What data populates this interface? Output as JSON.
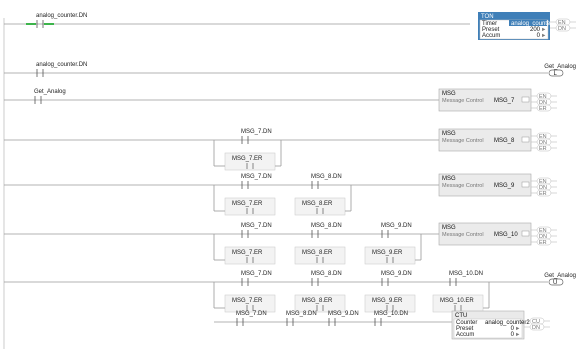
{
  "rungs": [
    {
      "contacts": [
        "analog_counter.DN"
      ],
      "instruction": {
        "type": "TON",
        "rows": [
          {
            "label": "Timer",
            "value": "analog_counter"
          },
          {
            "label": "Preset",
            "value": "200"
          },
          {
            "label": "Accum",
            "value": "0"
          }
        ],
        "outputs": [
          "EN",
          "DN"
        ]
      }
    },
    {
      "contacts": [
        "analog_counter.DN"
      ],
      "coil": {
        "tag": "Get_Analog",
        "type": "L"
      }
    },
    {
      "contacts": [
        "Get_Analog"
      ],
      "instruction": {
        "type": "MSG",
        "label": "Message Control",
        "tag": "MSG_7",
        "outputs": [
          "EN",
          "DN",
          "ER"
        ]
      }
    },
    {
      "contacts": [
        "MSG_7.DN"
      ],
      "branch": [
        "MSG_7.ER"
      ],
      "instruction": {
        "type": "MSG",
        "label": "Message Control",
        "tag": "MSG_8",
        "outputs": [
          "EN",
          "DN",
          "ER"
        ]
      }
    },
    {
      "contacts": [
        "MSG_7.DN",
        "MSG_8.DN"
      ],
      "branch": [
        "MSG_7.ER",
        "MSG_8.ER"
      ],
      "instruction": {
        "type": "MSG",
        "label": "Message Control",
        "tag": "MSG_9",
        "outputs": [
          "EN",
          "DN",
          "ER"
        ]
      }
    },
    {
      "contacts": [
        "MSG_7.DN",
        "MSG_8.DN",
        "MSG_9.DN"
      ],
      "branch": [
        "MSG_7.ER",
        "MSG_8.ER",
        "MSG_9.ER"
      ],
      "instruction": {
        "type": "MSG",
        "label": "Message Control",
        "tag": "MSG_10",
        "outputs": [
          "EN",
          "DN",
          "ER"
        ]
      }
    },
    {
      "contacts": [
        "MSG_7.DN",
        "MSG_8.DN",
        "MSG_9.DN",
        "MSG_10.DN"
      ],
      "branch": [
        "MSG_7.ER",
        "MSG_8.ER",
        "MSG_9.ER",
        "MSG_10.ER"
      ],
      "coil": {
        "tag": "Get_Analog",
        "type": "U"
      }
    },
    {
      "contacts": [
        "MSG_7.DN",
        "MSG_8.DN",
        "MSG_9.DN",
        "MSG_10.DN"
      ],
      "instruction": {
        "type": "CTU",
        "rows": [
          {
            "label": "Counter",
            "value": "analog_counter2"
          },
          {
            "label": "Preset",
            "value": "0"
          },
          {
            "label": "Accum",
            "value": "0"
          }
        ],
        "outputs": [
          "CU",
          "DN"
        ]
      }
    }
  ],
  "colors": {
    "energized": "#3cb44b",
    "selected": "#3f7fb8",
    "wire": "#9a9a9a"
  },
  "icons": {
    "browse": "ellipsis-button-icon",
    "arrow": "value-arrow-icon"
  }
}
